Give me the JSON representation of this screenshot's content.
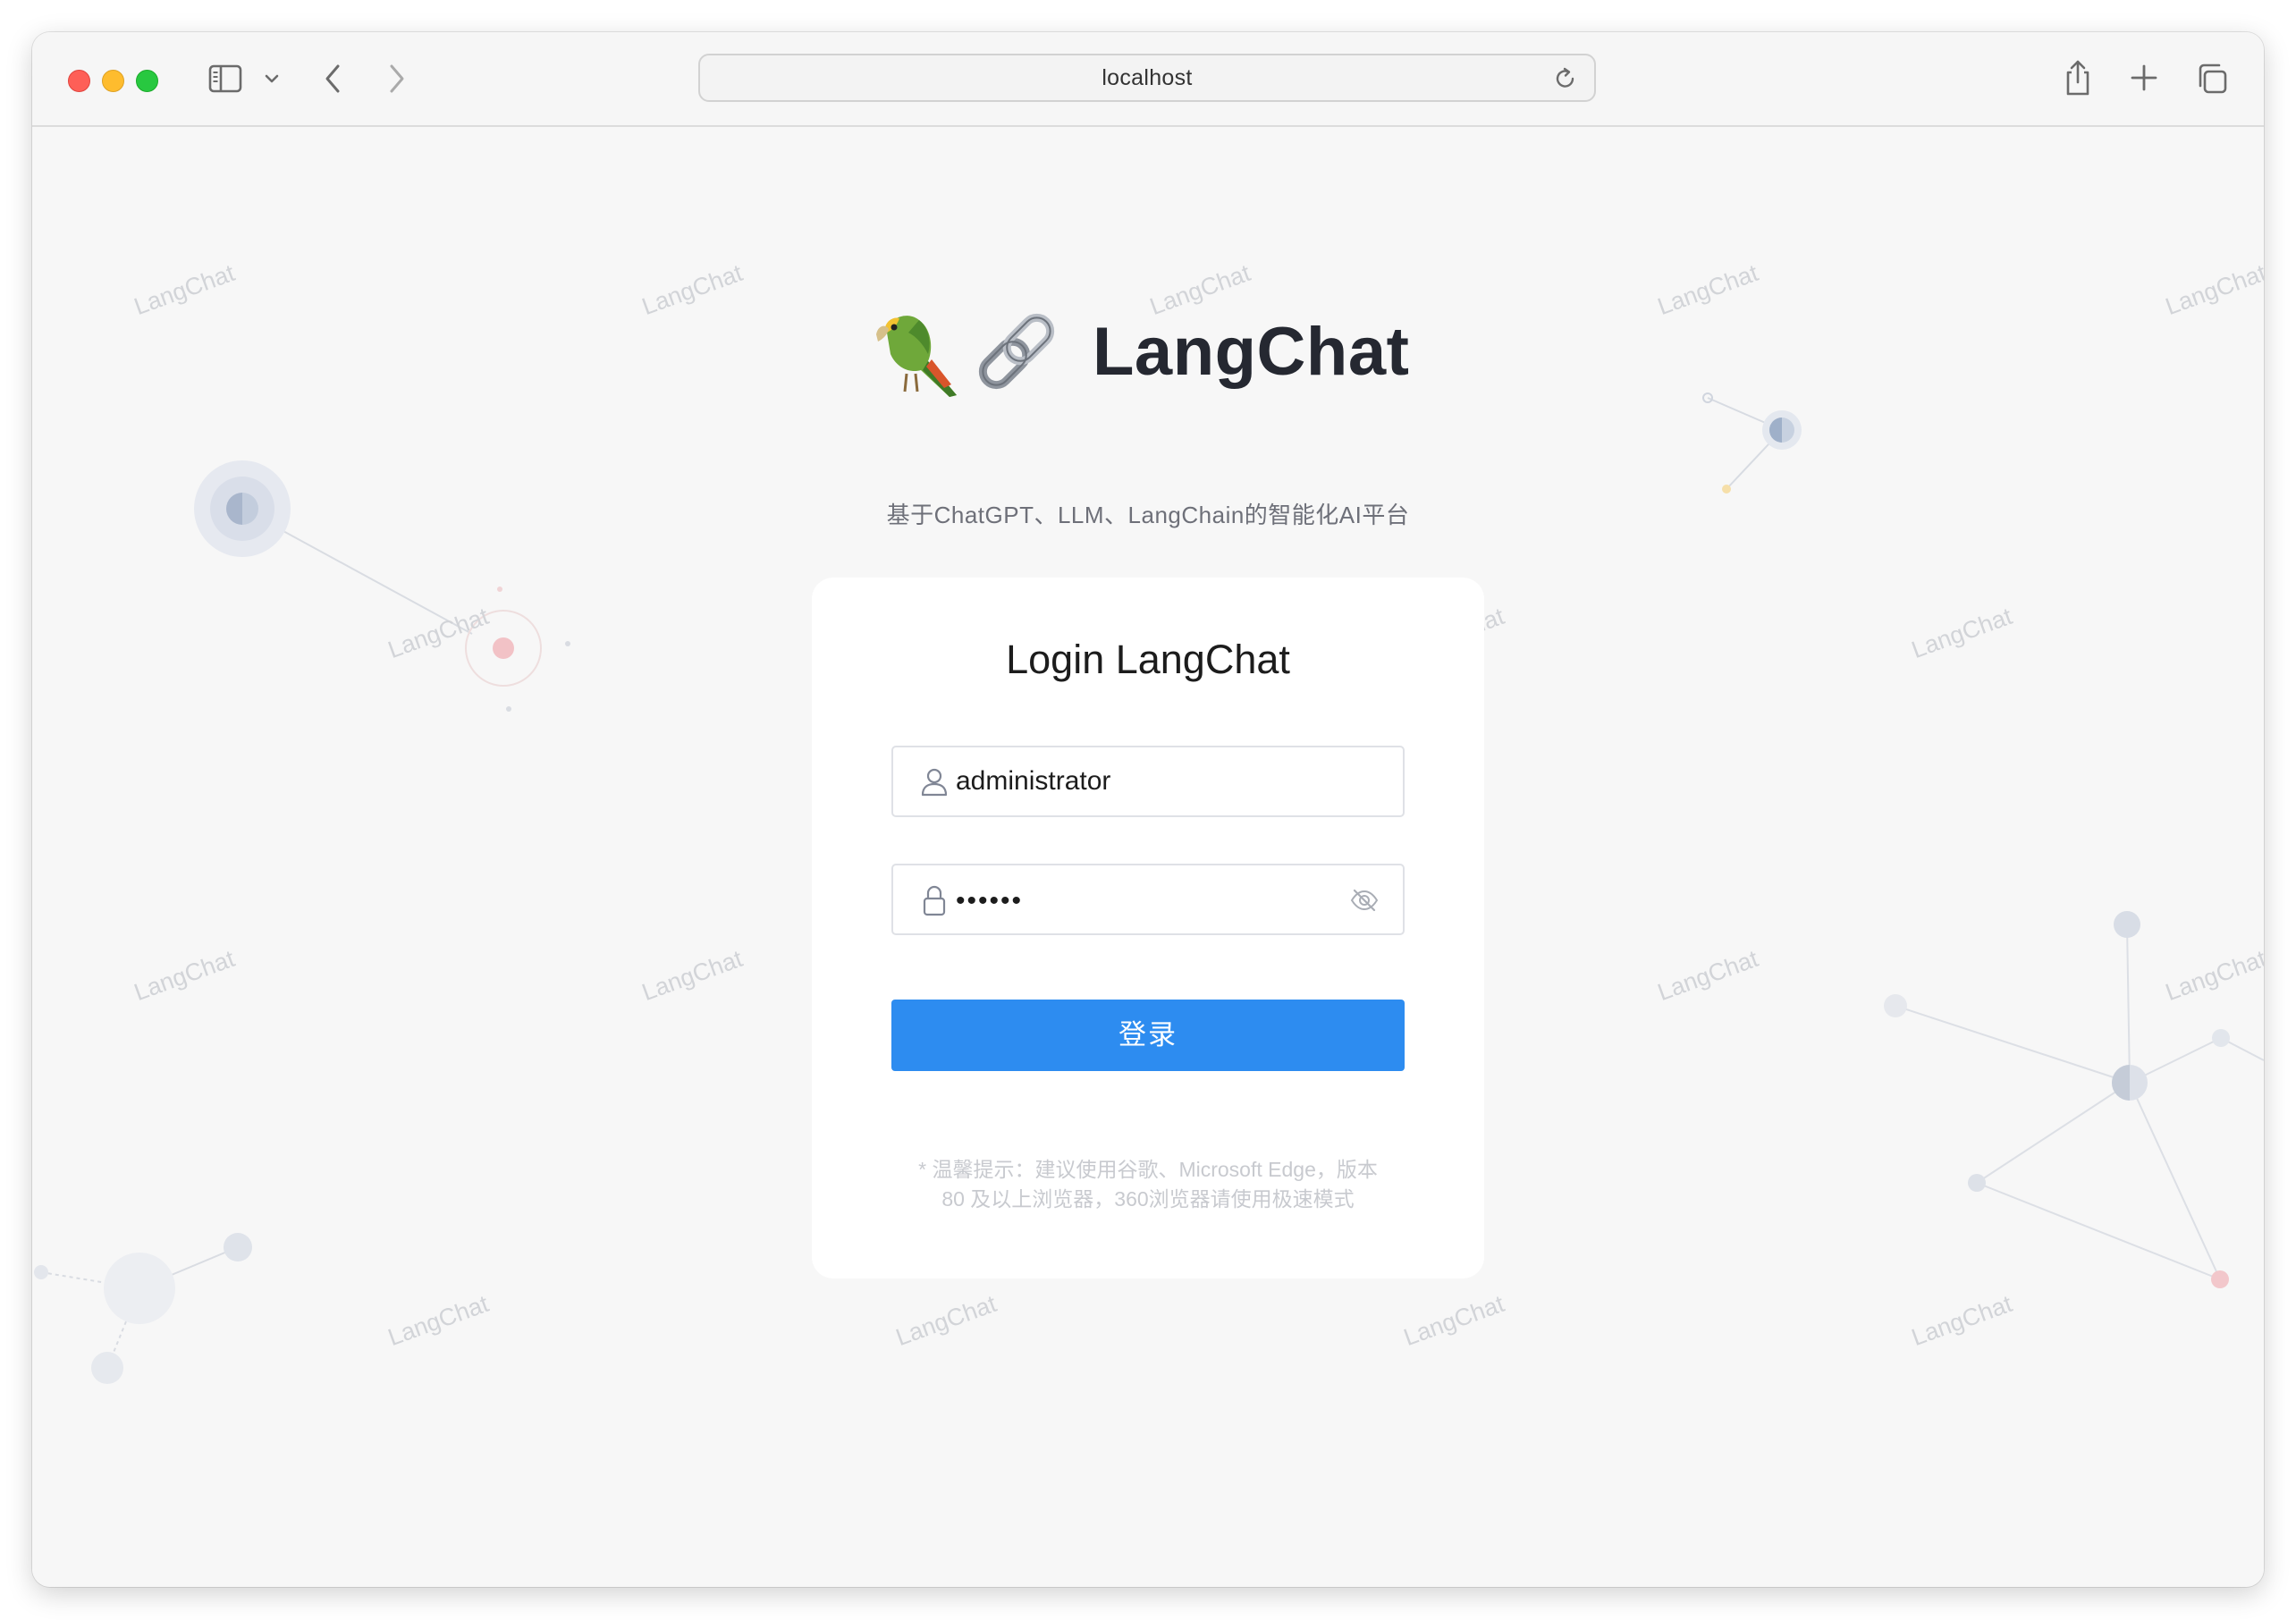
{
  "browser": {
    "url": "localhost",
    "controls": {
      "sidebar": "sidebar-icon",
      "back": "chevron-left-icon",
      "forward": "chevron-right-icon",
      "reload": "reload-icon",
      "share": "share-icon",
      "new_tab": "plus-icon",
      "tabs": "tabs-icon"
    }
  },
  "page": {
    "brand": "LangChat",
    "subtitle": "基于ChatGPT、LLM、LangChain的智能化AI平台",
    "watermark": "LangChat",
    "logo_emoji": "🦜🔗"
  },
  "login": {
    "title": "Login LangChat",
    "username_value": "administrator",
    "password_mask": "••••••",
    "submit_label": "登录",
    "tip_line1": "* 温馨提示：建议使用谷歌、Microsoft Edge，版本",
    "tip_line2": "80 及以上浏览器，360浏览器请使用极速模式"
  },
  "colors": {
    "accent": "#2d8cf0",
    "background": "#f7f7f7",
    "card": "#ffffff"
  }
}
